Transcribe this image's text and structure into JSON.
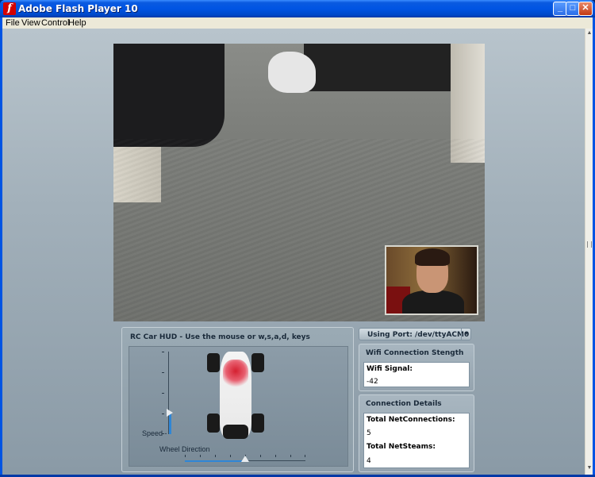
{
  "window": {
    "title": "Adobe Flash Player 10",
    "minimize_glyph": "_",
    "maximize_glyph": "□",
    "close_glyph": "✕"
  },
  "menu": {
    "items": [
      "File",
      "View",
      "Control",
      "Help"
    ]
  },
  "hud": {
    "title": "RC Car HUD - Use the mouse or w,s,a,d, keys",
    "speed_label": "Speed -",
    "wheel_label": "Wheel Direction",
    "speed_level": 0.26,
    "wheel_level": 0.5
  },
  "port": {
    "label": "Using Port: /dev/ttyACM0",
    "arrow": "▼"
  },
  "wifi": {
    "title": "Wifi Connection Stength",
    "signal_label": "Wifi Signal:",
    "signal_value": "-42"
  },
  "connection": {
    "title": "Connection Details",
    "netconnections_label": "Total NetConnections:",
    "netconnections_value": "5",
    "netstreams_label": "Total NetSteams:",
    "netstreams_value": "4"
  },
  "scrollbar": {
    "up_arrow": "▲",
    "down_arrow": "▼"
  },
  "icons": {
    "app": "flash-icon"
  },
  "colors": {
    "titlebar": "#0054e3",
    "accent": "#2f86d6",
    "panel": "#9aaab4"
  }
}
